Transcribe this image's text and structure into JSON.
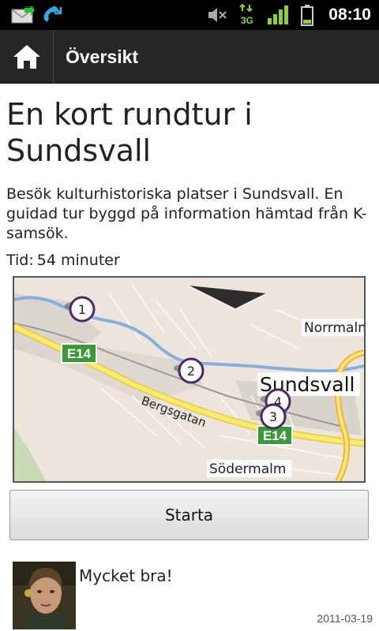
{
  "status_bar": {
    "time": "08:10",
    "network_label": "3G",
    "icons": [
      "mail-icon",
      "missed-call-icon",
      "mute-icon",
      "network-3g-icon",
      "signal-icon",
      "battery-icon"
    ]
  },
  "action_bar": {
    "title": "Översikt",
    "home_icon": "home-icon"
  },
  "tour": {
    "title": "En kort rundtur i Sundsvall",
    "description": "Besök kulturhistoriska platser i Sundsvall. En guidad tur byggd på information hämtad från K-samsök.",
    "duration_label": "Tid:",
    "duration_value": "54 minuter"
  },
  "map": {
    "labels": {
      "city": "Sundsvall",
      "district_north": "Norrmalm",
      "district_south": "Södermalm",
      "street": "Bergsgatan",
      "road_west": "E14",
      "road_center": "E14"
    },
    "markers": [
      "1",
      "2",
      "3",
      "4"
    ]
  },
  "start_button": {
    "label": "Starta"
  },
  "comment": {
    "text": "Mycket bra!",
    "date": "2011-03-19"
  },
  "colors": {
    "status_bar": "#000000",
    "action_bar": "#262626",
    "road_yellow": "#f8e95b",
    "water": "#7ba7d8",
    "marker_ring": "#4b2a63",
    "highway_shield": "#3a9a3a"
  }
}
